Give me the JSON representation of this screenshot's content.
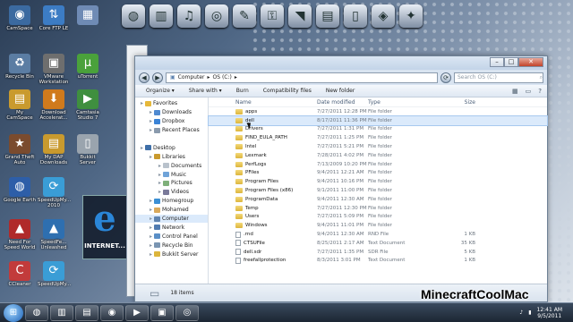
{
  "desktop_icons": [
    {
      "label": "CamSpace",
      "icon": "camera-icon",
      "color": "#3b6aa0",
      "glyph": "◉"
    },
    {
      "label": "Core FTP LE",
      "icon": "ftp-icon",
      "color": "#3c7cc4",
      "glyph": "⇅"
    },
    {
      "label": "",
      "icon": "calendar-icon",
      "color": "#6f8bb5",
      "glyph": "▦"
    },
    {
      "label": "Recycle Bin",
      "icon": "recycle-bin-icon",
      "color": "#5b7da3",
      "glyph": "♻"
    },
    {
      "label": "VMware Workstation",
      "icon": "vmware-icon",
      "color": "#6e6e6e",
      "glyph": "▣"
    },
    {
      "label": "uTorrent",
      "icon": "utorrent-icon",
      "color": "#4aa13b",
      "glyph": "µ"
    },
    {
      "label": "My CamSpace",
      "icon": "folder-icon",
      "color": "#c99a2e",
      "glyph": "▤"
    },
    {
      "label": "Download Accelerat...",
      "icon": "download-icon",
      "color": "#d07a1c",
      "glyph": "⬇"
    },
    {
      "label": "Camtasia Studio 7",
      "icon": "camtasia-icon",
      "color": "#3f8f3f",
      "glyph": "▶"
    },
    {
      "label": "Grand Theft Auto",
      "icon": "game-icon",
      "color": "#7a4b2e",
      "glyph": "★"
    },
    {
      "label": "My DAP Downloads",
      "icon": "folder-icon",
      "color": "#c99a2e",
      "glyph": "▤"
    },
    {
      "label": "Bukkit Server",
      "icon": "file-icon",
      "color": "#9aa4ae",
      "glyph": "▯"
    },
    {
      "label": "Google Earth",
      "icon": "globe-icon",
      "color": "#2d5ea8",
      "glyph": "◍"
    },
    {
      "label": "SpeedUpMy... 2010",
      "icon": "speedup-icon",
      "color": "#3a9dd6",
      "glyph": "⟳"
    },
    {
      "label": "",
      "icon": "",
      "color": "",
      "glyph": ""
    },
    {
      "label": "Need For Speed World",
      "icon": "nfs-icon",
      "color": "#b02a2a",
      "glyph": "▲"
    },
    {
      "label": "SpeedFe... Unleashed",
      "icon": "speedfe-icon",
      "color": "#2e6fb0",
      "glyph": "▲"
    },
    {
      "label": "",
      "icon": "",
      "color": "",
      "glyph": ""
    },
    {
      "label": "CCleaner",
      "icon": "ccleaner-icon",
      "color": "#c23b3b",
      "glyph": "C"
    },
    {
      "label": "SpeedUpMy...",
      "icon": "speedup-icon",
      "color": "#3a9dd6",
      "glyph": "⟳"
    }
  ],
  "ie_icon": {
    "label": "INTERNET...",
    "glyph": "e"
  },
  "dock": [
    {
      "icon": "globe-icon",
      "glyph": "◍"
    },
    {
      "icon": "library-icon",
      "glyph": "▥"
    },
    {
      "icon": "headphones-icon",
      "glyph": "♫"
    },
    {
      "icon": "film-icon",
      "glyph": "◎"
    },
    {
      "icon": "notes-icon",
      "glyph": "✎"
    },
    {
      "icon": "lock-icon",
      "glyph": "⚿"
    },
    {
      "icon": "arrow-icon",
      "glyph": "◥"
    },
    {
      "icon": "document-icon",
      "glyph": "▤"
    },
    {
      "icon": "trash-icon",
      "glyph": "▯"
    },
    {
      "icon": "shield-icon",
      "glyph": "◈"
    },
    {
      "icon": "gift-icon",
      "glyph": "✦"
    }
  ],
  "explorer": {
    "breadcrumb": [
      "Computer",
      "OS (C:)"
    ],
    "search_placeholder": "Search OS (C:)",
    "toolbar": [
      "Organize ▾",
      "Share with ▾",
      "Burn",
      "Compatibility files",
      "New folder"
    ],
    "columns": {
      "name": "Name",
      "date": "Date modified",
      "type": "Type",
      "size": "Size"
    },
    "nav": [
      {
        "label": "Favorites",
        "level": 0,
        "icon": "star-icon",
        "color": "#e6b83a"
      },
      {
        "label": "Downloads",
        "level": 1,
        "icon": "downloads-folder-icon",
        "color": "#4f8ad1"
      },
      {
        "label": "Dropbox",
        "level": 1,
        "icon": "dropbox-icon",
        "color": "#3a83d6"
      },
      {
        "label": "Recent Places",
        "level": 1,
        "icon": "recent-places-icon",
        "color": "#8a9aad"
      },
      {
        "label": "",
        "level": 0,
        "icon": "",
        "color": ""
      },
      {
        "label": "Desktop",
        "level": 0,
        "icon": "desktop-icon",
        "color": "#3f6fa8"
      },
      {
        "label": "Libraries",
        "level": 1,
        "icon": "libraries-icon",
        "color": "#c99a2e"
      },
      {
        "label": "Documents",
        "level": 2,
        "icon": "documents-icon",
        "color": "#b9c2cc"
      },
      {
        "label": "Music",
        "level": 2,
        "icon": "music-icon",
        "color": "#6fa3d8"
      },
      {
        "label": "Pictures",
        "level": 2,
        "icon": "pictures-icon",
        "color": "#7fb07a"
      },
      {
        "label": "Videos",
        "level": 2,
        "icon": "videos-icon",
        "color": "#7a7a9a"
      },
      {
        "label": "Homegroup",
        "level": 1,
        "icon": "homegroup-icon",
        "color": "#3b8fd4"
      },
      {
        "label": "Mohamed",
        "level": 1,
        "icon": "user-icon",
        "color": "#d9a95b"
      },
      {
        "label": "Computer",
        "level": 1,
        "icon": "computer-icon",
        "color": "#5f84b0",
        "selected": true
      },
      {
        "label": "Network",
        "level": 1,
        "icon": "network-icon",
        "color": "#4f7bb1"
      },
      {
        "label": "Control Panel",
        "level": 1,
        "icon": "control-panel-icon",
        "color": "#5a8fc7"
      },
      {
        "label": "Recycle Bin",
        "level": 1,
        "icon": "recycle-bin-icon",
        "color": "#7a95b2"
      },
      {
        "label": "Bukkit Server",
        "level": 1,
        "icon": "folder-icon",
        "color": "#dcb53c"
      }
    ],
    "files": [
      {
        "name": "apps",
        "date": "7/27/2011 12:28 PM",
        "type": "File folder",
        "size": "",
        "kind": "folder"
      },
      {
        "name": "dell",
        "date": "8/17/2011 11:36 PM",
        "type": "File folder",
        "size": "",
        "kind": "folder",
        "selected": true
      },
      {
        "name": "Drivers",
        "date": "7/27/2011 1:31 PM",
        "type": "File folder",
        "size": "",
        "kind": "folder"
      },
      {
        "name": "FIND_EULA_PATH",
        "date": "7/27/2011 1:25 PM",
        "type": "File folder",
        "size": "",
        "kind": "folder"
      },
      {
        "name": "Intel",
        "date": "7/27/2011 5:21 PM",
        "type": "File folder",
        "size": "",
        "kind": "folder"
      },
      {
        "name": "Lexmark",
        "date": "7/28/2011 4:02 PM",
        "type": "File folder",
        "size": "",
        "kind": "folder"
      },
      {
        "name": "PerfLogs",
        "date": "7/13/2009 10:20 PM",
        "type": "File folder",
        "size": "",
        "kind": "folder"
      },
      {
        "name": "PFiles",
        "date": "9/4/2011 12:21 AM",
        "type": "File folder",
        "size": "",
        "kind": "folder"
      },
      {
        "name": "Program Files",
        "date": "9/4/2011 10:16 PM",
        "type": "File folder",
        "size": "",
        "kind": "folder"
      },
      {
        "name": "Program Files (x86)",
        "date": "9/1/2011 11:00 PM",
        "type": "File folder",
        "size": "",
        "kind": "folder"
      },
      {
        "name": "ProgramData",
        "date": "9/4/2011 12:30 AM",
        "type": "File folder",
        "size": "",
        "kind": "folder"
      },
      {
        "name": "Temp",
        "date": "7/27/2011 12:30 PM",
        "type": "File folder",
        "size": "",
        "kind": "folder"
      },
      {
        "name": "Users",
        "date": "7/27/2011 5:09 PM",
        "type": "File folder",
        "size": "",
        "kind": "folder"
      },
      {
        "name": "Windows",
        "date": "9/4/2011 11:01 PM",
        "type": "File folder",
        "size": "",
        "kind": "folder"
      },
      {
        "name": ".rnd",
        "date": "9/4/2011 12:30 AM",
        "type": "RND File",
        "size": "1 KB",
        "kind": "file"
      },
      {
        "name": "CTSUFile",
        "date": "8/25/2011 2:17 AM",
        "type": "Text Document",
        "size": "35 KB",
        "kind": "file"
      },
      {
        "name": "dell.sdr",
        "date": "7/27/2011 1:35 PM",
        "type": "SDR File",
        "size": "5 KB",
        "kind": "file"
      },
      {
        "name": "freefallprotection",
        "date": "8/3/2011 3:01 PM",
        "type": "Text Document",
        "size": "1 KB",
        "kind": "file"
      }
    ],
    "status": "18 items"
  },
  "watermark": "MinecraftCoolMac",
  "taskbar": {
    "items": [
      {
        "icon": "dell-icon",
        "glyph": "◍"
      },
      {
        "icon": "library-icon",
        "glyph": "▥"
      },
      {
        "icon": "windows-explorer-icon",
        "glyph": "▤"
      },
      {
        "icon": "chrome-icon",
        "glyph": "◉"
      },
      {
        "icon": "film-icon",
        "glyph": "▶"
      },
      {
        "icon": "minecraft-icon",
        "glyph": "▣"
      },
      {
        "icon": "camera-icon",
        "glyph": "◎"
      }
    ],
    "time": "12:41 AM",
    "date": "9/5/2011"
  }
}
